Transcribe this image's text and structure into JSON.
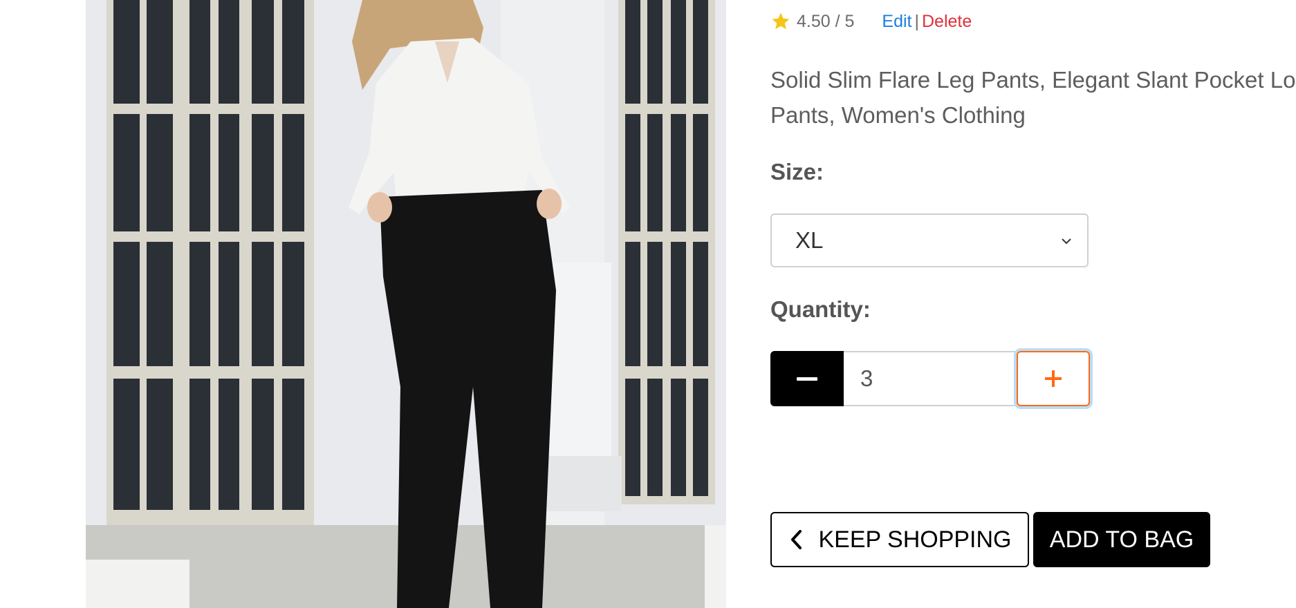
{
  "product": {
    "image_alt": "Woman wearing a white satin shirt and black flare leg pants",
    "rating_text": "4.50 / 5",
    "edit_label": "Edit",
    "separator": "|",
    "delete_label": "Delete",
    "title_line1": "Solid Slim Flare Leg Pants, Elegant Slant Pocket Long",
    "title_line2": "Pants, Women's Clothing"
  },
  "size": {
    "label": "Size:",
    "selected": "XL"
  },
  "quantity": {
    "label": "Quantity:",
    "value": "3"
  },
  "actions": {
    "keep_shopping_label": "KEEP SHOPPING",
    "add_to_bag_label": "ADD TO BAG"
  },
  "colors": {
    "star": "#f5c518",
    "edit_link": "#1a7fe0",
    "delete_link": "#e0303a",
    "plus_accent": "#ff6a13",
    "focus_ring": "#bcdcf5"
  },
  "icons": [
    "star-icon",
    "chevron-down-icon",
    "minus-icon",
    "plus-icon",
    "chevron-left-icon"
  ]
}
